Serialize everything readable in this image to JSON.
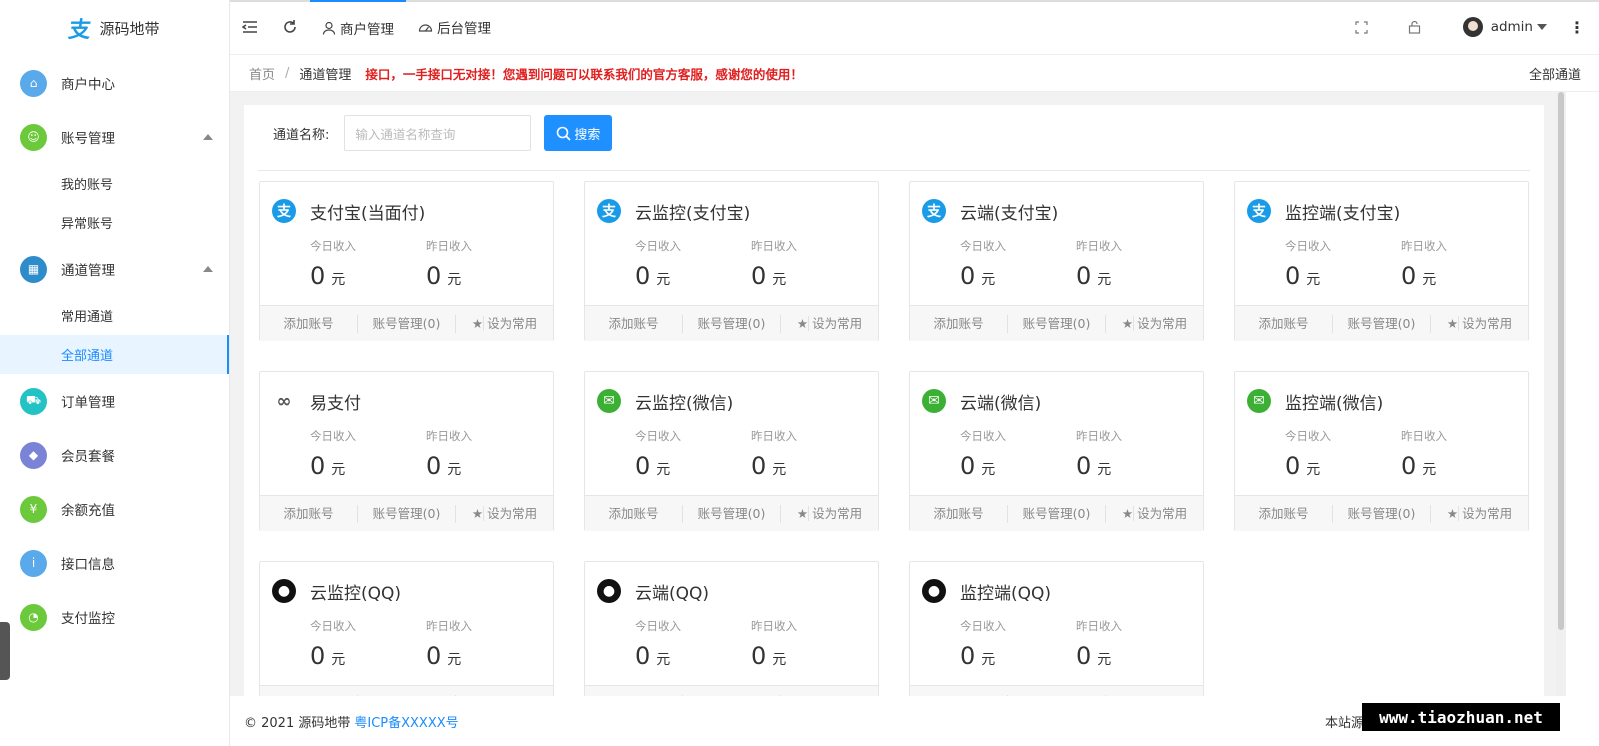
{
  "logo": {
    "name": "源码地带",
    "mark": "支"
  },
  "sidebar": {
    "items": [
      {
        "label": "商户中心",
        "color": "#5aa9ea",
        "glyph": "⌂"
      },
      {
        "label": "账号管理",
        "color": "#6cc93b",
        "glyph": "☺"
      },
      {
        "label": "通道管理",
        "color": "#2d8cc9",
        "glyph": "▦"
      },
      {
        "label": "订单管理",
        "color": "#22c2c5",
        "glyph": "⛟"
      },
      {
        "label": "会员套餐",
        "color": "#7b83d6",
        "glyph": "◆"
      },
      {
        "label": "余额充值",
        "color": "#6cc93b",
        "glyph": "¥"
      },
      {
        "label": "接口信息",
        "color": "#5aa9ea",
        "glyph": "i"
      },
      {
        "label": "支付监控",
        "color": "#6cc93b",
        "glyph": "◔"
      }
    ],
    "account_sub": [
      "我的账号",
      "异常账号"
    ],
    "channel_sub": [
      "常用通道",
      "全部通道"
    ]
  },
  "topbar": {
    "tab1": "商户管理",
    "tab2": "后台管理",
    "user": "admin"
  },
  "crumbs": {
    "home": "首页",
    "sep": "/",
    "current": "通道管理",
    "notice": "接口，一手接口无对接！您遇到问题可以联系我们的官方客服，感谢您的使用！",
    "right": "全部通道"
  },
  "search": {
    "label": "通道名称:",
    "placeholder": "输入通道名称查询",
    "button": "搜索"
  },
  "card_labels": {
    "today": "今日收入",
    "yesterday": "昨日收入",
    "unit": "元",
    "add": "添加账号",
    "manage": "账号管理(0)",
    "fav": "设为常用"
  },
  "cards": [
    {
      "title": "支付宝(当面付)",
      "type": "alipay",
      "today": "0",
      "yesterday": "0"
    },
    {
      "title": "云监控(支付宝)",
      "type": "alipay",
      "today": "0",
      "yesterday": "0"
    },
    {
      "title": "云端(支付宝)",
      "type": "alipay",
      "today": "0",
      "yesterday": "0"
    },
    {
      "title": "监控端(支付宝)",
      "type": "alipay",
      "today": "0",
      "yesterday": "0"
    },
    {
      "title": "易支付",
      "type": "epay",
      "today": "0",
      "yesterday": "0"
    },
    {
      "title": "云监控(微信)",
      "type": "wechat",
      "today": "0",
      "yesterday": "0"
    },
    {
      "title": "云端(微信)",
      "type": "wechat",
      "today": "0",
      "yesterday": "0"
    },
    {
      "title": "监控端(微信)",
      "type": "wechat",
      "today": "0",
      "yesterday": "0"
    },
    {
      "title": "云监控(QQ)",
      "type": "qq",
      "today": "0",
      "yesterday": "0"
    },
    {
      "title": "云端(QQ)",
      "type": "qq",
      "today": "0",
      "yesterday": "0"
    },
    {
      "title": "监控端(QQ)",
      "type": "qq",
      "today": "0",
      "yesterday": "0"
    }
  ],
  "footer": {
    "copy": "© 2021 源码地带",
    "icp": "粤ICP备XXXXX号",
    "right": "本站源"
  },
  "watermark": "www.tiaozhuan.net",
  "colors": {
    "accent": "#1e90ff",
    "alipay": "#1a9be8",
    "wechat": "#3cb034",
    "notice": "#e02020"
  }
}
